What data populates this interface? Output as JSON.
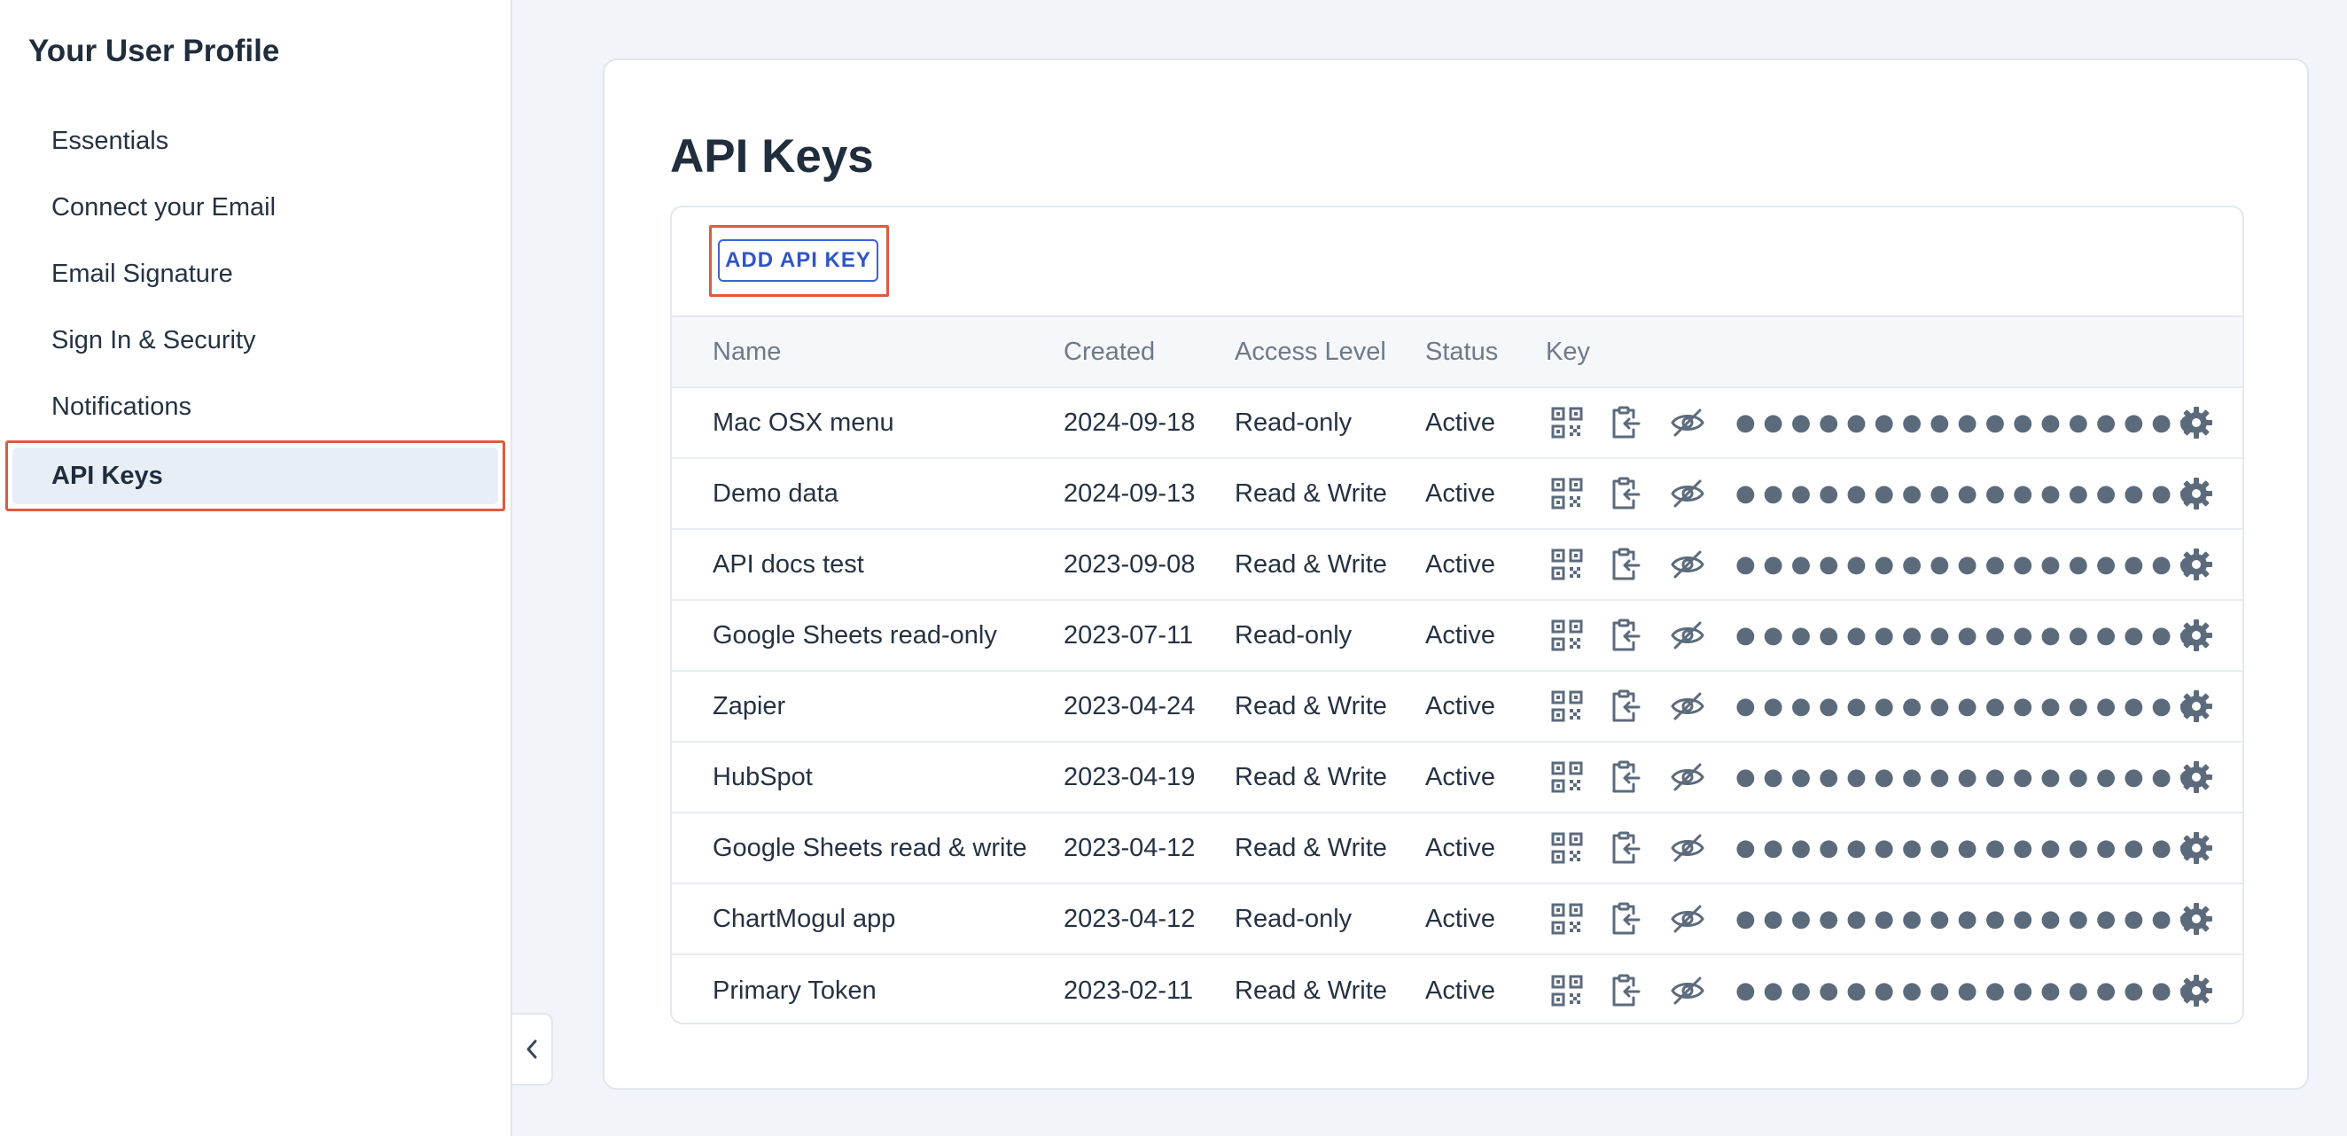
{
  "sidebar": {
    "title": "Your User Profile",
    "items": [
      {
        "label": "Essentials"
      },
      {
        "label": "Connect your Email"
      },
      {
        "label": "Email Signature"
      },
      {
        "label": "Sign In & Security"
      },
      {
        "label": "Notifications"
      },
      {
        "label": "API Keys",
        "active": true
      }
    ]
  },
  "main": {
    "title": "API Keys",
    "add_button_label": "ADD API KEY",
    "columns": [
      "Name",
      "Created",
      "Access Level",
      "Status",
      "Key"
    ],
    "rows": [
      {
        "name": "Mac OSX menu",
        "created": "2024-09-18",
        "access": "Read-only",
        "status": "Active",
        "key_masked": "●●●●●●●●●●●●●●●●●"
      },
      {
        "name": "Demo data",
        "created": "2024-09-13",
        "access": "Read & Write",
        "status": "Active",
        "key_masked": "●●●●●●●●●●●●●●●●●"
      },
      {
        "name": "API docs test",
        "created": "2023-09-08",
        "access": "Read & Write",
        "status": "Active",
        "key_masked": "●●●●●●●●●●●●●●●●●"
      },
      {
        "name": "Google Sheets read-only",
        "created": "2023-07-11",
        "access": "Read-only",
        "status": "Active",
        "key_masked": "●●●●●●●●●●●●●●●●●"
      },
      {
        "name": "Zapier",
        "created": "2023-04-24",
        "access": "Read & Write",
        "status": "Active",
        "key_masked": "●●●●●●●●●●●●●●●●●"
      },
      {
        "name": "HubSpot",
        "created": "2023-04-19",
        "access": "Read & Write",
        "status": "Active",
        "key_masked": "●●●●●●●●●●●●●●●●●"
      },
      {
        "name": "Google Sheets read & write",
        "created": "2023-04-12",
        "access": "Read & Write",
        "status": "Active",
        "key_masked": "●●●●●●●●●●●●●●●●●"
      },
      {
        "name": "ChartMogul app",
        "created": "2023-04-12",
        "access": "Read-only",
        "status": "Active",
        "key_masked": "●●●●●●●●●●●●●●●●●"
      },
      {
        "name": "Primary Token",
        "created": "2023-02-11",
        "access": "Read & Write",
        "status": "Active",
        "key_masked": "●●●●●●●●●●●●●●●●●"
      }
    ]
  },
  "icons": {
    "qr": "qr-code-icon",
    "copy": "clipboard-copy-icon",
    "reveal": "eye-off-icon",
    "settings": "gear-icon",
    "collapse": "chevron-left-icon"
  },
  "colors": {
    "accent": "#2f55c7",
    "highlight": "#e05a3e",
    "background": "#f1f4f9",
    "text": "#1f2d3d",
    "muted": "#6e7a89"
  }
}
